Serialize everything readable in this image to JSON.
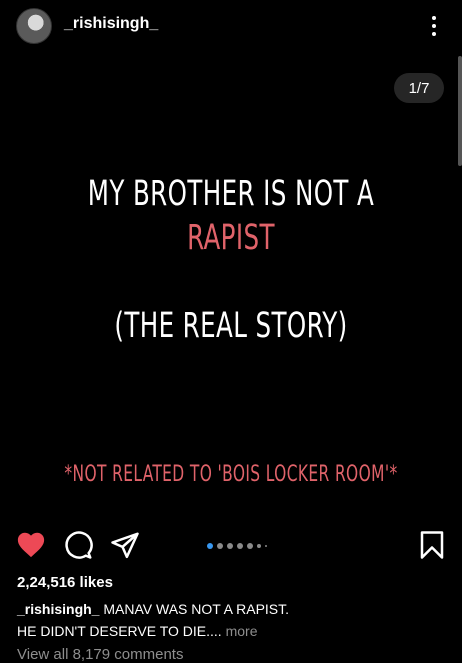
{
  "header": {
    "username": "_rishisingh_"
  },
  "post": {
    "counter": "1/7",
    "slide_lines": {
      "line1": "MY BROTHER IS NOT A",
      "line2": "RAPIST",
      "line3": "(THE REAL STORY)",
      "line4": "*NOT RELATED TO 'BOIS LOCKER ROOM'*"
    }
  },
  "actions": {
    "icons": [
      "heart-icon",
      "comment-icon",
      "share-icon",
      "bookmark-icon"
    ],
    "heart_color": "#ed4956",
    "carousel_active_index": 0,
    "carousel_count": 7
  },
  "likes": "2,24,516 likes",
  "caption": {
    "username": "_rishisingh_",
    "text_line1": "MANAV WAS NOT A RAPIST.",
    "text_line2": "HE DIDN'T DESERVE TO DIE....",
    "more": "more"
  },
  "comments": {
    "view_all": "View all 8,179 comments"
  },
  "colors": {
    "accent_red_text": "#e0636a",
    "carousel_active": "#3897f0",
    "background": "#000000"
  }
}
